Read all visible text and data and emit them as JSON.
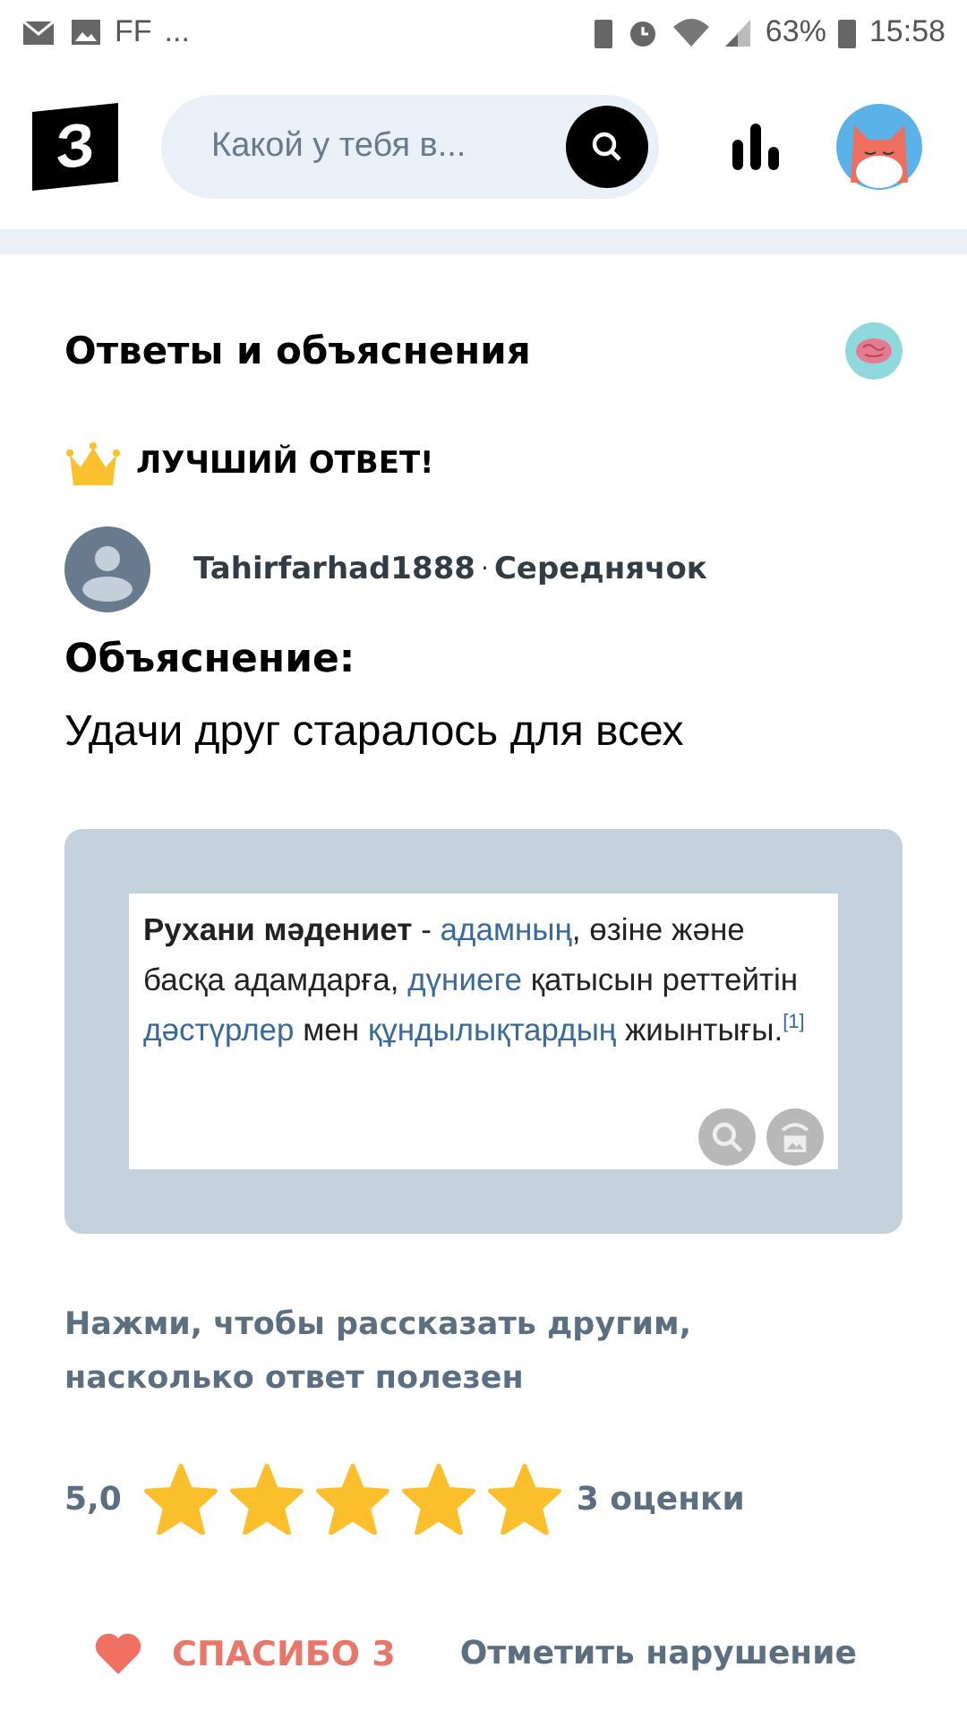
{
  "status_bar": {
    "left_text": [
      "FF",
      "..."
    ],
    "battery": "63%",
    "time": "15:58"
  },
  "header": {
    "logo": "З",
    "search": {
      "placeholder": "Какой у тебя в..."
    }
  },
  "section_title": "Ответы и объяснения",
  "best_answer": {
    "label": "ЛУЧШИЙ ОТВЕТ!"
  },
  "author": {
    "name": "Tahirfarhad1888",
    "separator": "·",
    "rank": "Середнячок"
  },
  "explanation_label": "Объяснение:",
  "answer_text": "Удачи друг старалось для всех",
  "attachment": {
    "segments": [
      {
        "kind": "bold",
        "text": "Рухани мәдениет"
      },
      {
        "kind": "plain",
        "text": " - "
      },
      {
        "kind": "link",
        "text": "адамның"
      },
      {
        "kind": "plain",
        "text": ", өзіне және басқа адамдарға, "
      },
      {
        "kind": "link",
        "text": "дүниеге"
      },
      {
        "kind": "plain",
        "text": " қатысын реттейтін "
      },
      {
        "kind": "link",
        "text": "дәстүрлер"
      },
      {
        "kind": "plain",
        "text": " мен "
      },
      {
        "kind": "link",
        "text": "құндылықтардың"
      },
      {
        "kind": "plain",
        "text": " жиынтығы."
      },
      {
        "kind": "ref",
        "text": "[1]"
      }
    ]
  },
  "rating_prompt": "Нажми, чтобы рассказать другим, насколько ответ полезен",
  "rating": {
    "value": "5,0",
    "stars": 5,
    "count": "3 оценки"
  },
  "footer": {
    "thanks": "СПАСИБО 3",
    "report": "Отметить нарушение"
  }
}
